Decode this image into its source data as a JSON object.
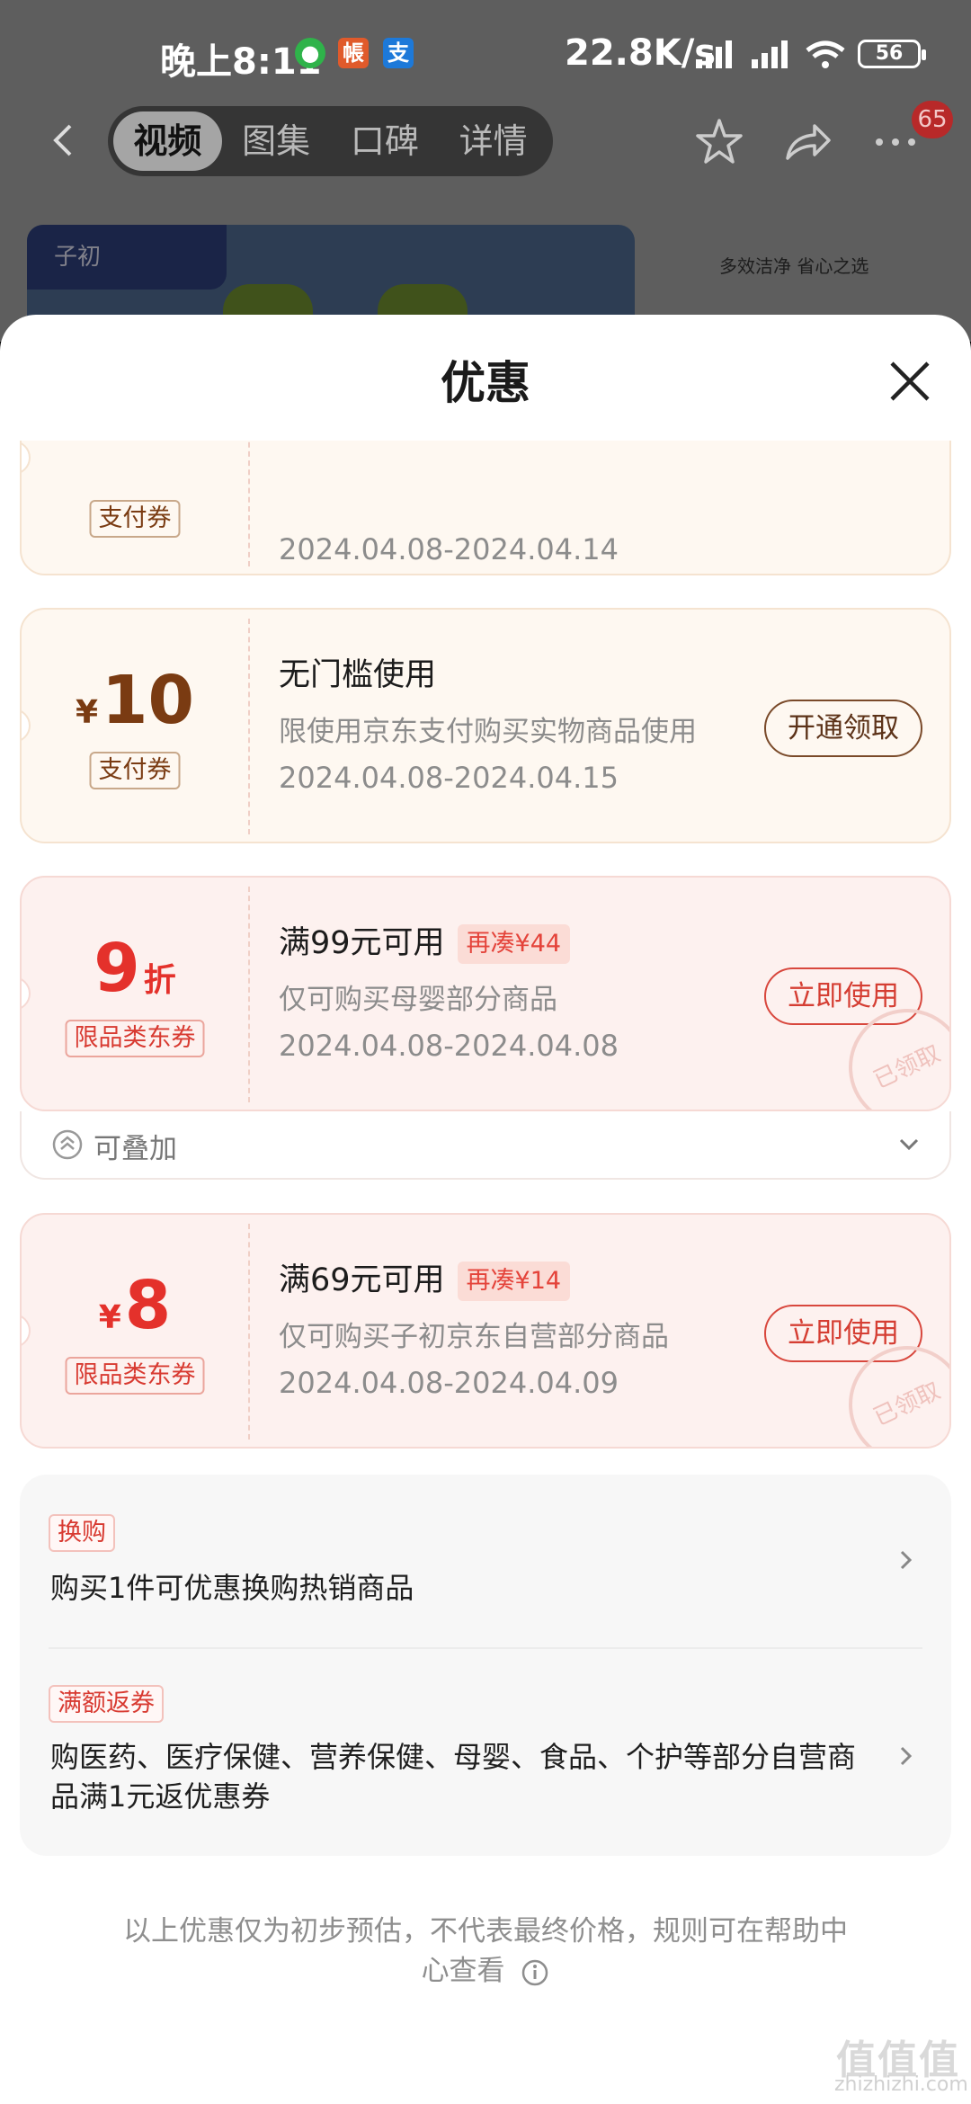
{
  "status_bar": {
    "time": "晚上8:11",
    "speed": "22.8K/s",
    "battery": "56",
    "app_icons": [
      "wechat-icon",
      "app-red-icon",
      "alipay-icon"
    ]
  },
  "nav": {
    "tabs": [
      {
        "label": "视频",
        "active": true
      },
      {
        "label": "图集",
        "active": false
      },
      {
        "label": "口碑",
        "active": false
      },
      {
        "label": "详情",
        "active": false
      }
    ],
    "message_badge": "65"
  },
  "banner": {
    "brand": "子初",
    "slogan": "多效洁净 省心之选"
  },
  "sheet": {
    "title": "优惠",
    "coupons": [
      {
        "amount_symbol": "¥",
        "amount": "",
        "unit": "",
        "tag": "支付券",
        "condition": "",
        "extra": "",
        "description": "",
        "date": "2024.04.08-2024.04.14",
        "button": "",
        "style": "gold"
      },
      {
        "amount_symbol": "¥",
        "amount": "10",
        "unit": "",
        "tag": "支付券",
        "condition": "无门槛使用",
        "extra": "",
        "description": "限使用京东支付购买实物商品使用",
        "date": "2024.04.08-2024.04.15",
        "button": "开通领取",
        "style": "gold"
      },
      {
        "amount_symbol": "",
        "amount": "9",
        "unit": "折",
        "tag": "限品类东券",
        "condition": "满99元可用",
        "extra": "再凑¥44",
        "description": "仅可购买母婴部分商品",
        "date": "2024.04.08-2024.04.08",
        "button": "立即使用",
        "style": "red",
        "stamp": "已领取",
        "stackable_label": "可叠加"
      },
      {
        "amount_symbol": "¥",
        "amount": "8",
        "unit": "",
        "tag": "限品类东券",
        "condition": "满69元可用",
        "extra": "再凑¥14",
        "description": "仅可购买子初京东自营部分商品",
        "date": "2024.04.08-2024.04.09",
        "button": "立即使用",
        "style": "red",
        "stamp": "已领取"
      }
    ],
    "promotions": [
      {
        "tag": "换购",
        "text": "购买1件可优惠换购热销商品"
      },
      {
        "tag": "满额返券",
        "text": "购医药、医疗保健、营养保健、母婴、食品、个护等部分自营商品满1元返优惠券"
      }
    ],
    "footnote": "以上优惠仅为初步预估，不代表最终价格，规则可在帮助中心查看"
  },
  "watermark": {
    "text": "值值值",
    "sub": "zhizhizhi.com"
  },
  "colors": {
    "gold_text": "#7a3b12",
    "red_text": "#e4312b",
    "gold_bg": "#fef8f1",
    "red_bg": "#fdf1ef"
  }
}
